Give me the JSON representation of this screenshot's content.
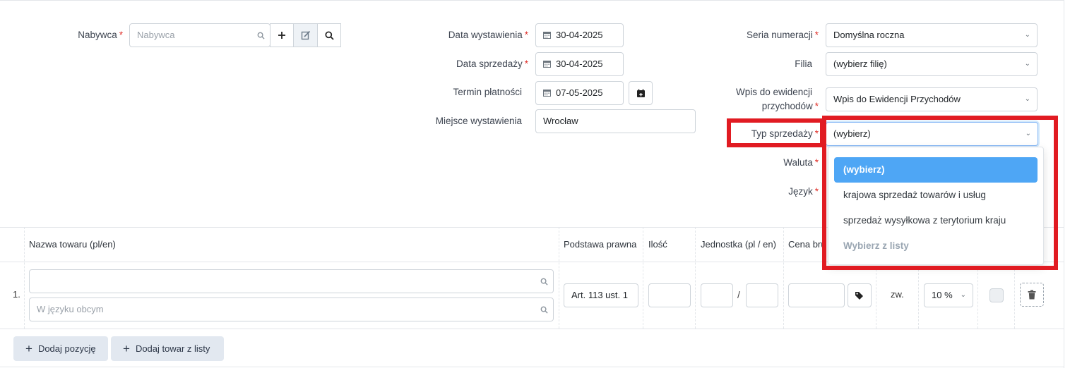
{
  "form": {
    "buyer": {
      "label": "Nabywca",
      "placeholder": "Nabywca"
    },
    "issue_date": {
      "label": "Data wystawienia",
      "value": "30-04-2025"
    },
    "sale_date": {
      "label": "Data sprzedaży",
      "value": "30-04-2025"
    },
    "payment_term": {
      "label": "Termin płatności",
      "value": "07-05-2025"
    },
    "issue_place": {
      "label": "Miejsce wystawienia",
      "value": "Wrocław"
    },
    "numbering_series": {
      "label": "Seria numeracji",
      "value": "Domyślna roczna"
    },
    "branch": {
      "label": "Filia",
      "value": "(wybierz filię)"
    },
    "income_register": {
      "label_line1": "Wpis do ewidencji",
      "label_line2": "przychodów",
      "value": "Wpis do Ewidencji Przychodów"
    },
    "sale_type": {
      "label": "Typ sprzedaży",
      "value": "(wybierz)"
    },
    "currency": {
      "label": "Waluta"
    },
    "language": {
      "label": "Język"
    },
    "required_mark": "*"
  },
  "dropdown": {
    "options": [
      "(wybierz)",
      "krajowa sprzedaż towarów i usług",
      "sprzedaż wysyłkowa z terytorium kraju",
      "Wybierz z listy"
    ]
  },
  "table": {
    "headers": [
      "Nazwa towaru (pl/en)",
      "Podstawa prawna",
      "Ilość",
      "Jednostka (pl / en)",
      "Cena brutto"
    ],
    "row": {
      "number": "1.",
      "foreign_placeholder": "W języku obcym",
      "legal_basis": "Art. 113 ust. 1",
      "unit_separator": "/",
      "vat_label": "zw.",
      "discount_value": "10 %"
    }
  },
  "actions": {
    "add_item": "Dodaj pozycję",
    "add_from_list": "Dodaj towar z listy"
  },
  "colors": {
    "highlight": "#e11b22",
    "active_option": "#4ea6f5",
    "required": "#e0302a"
  }
}
